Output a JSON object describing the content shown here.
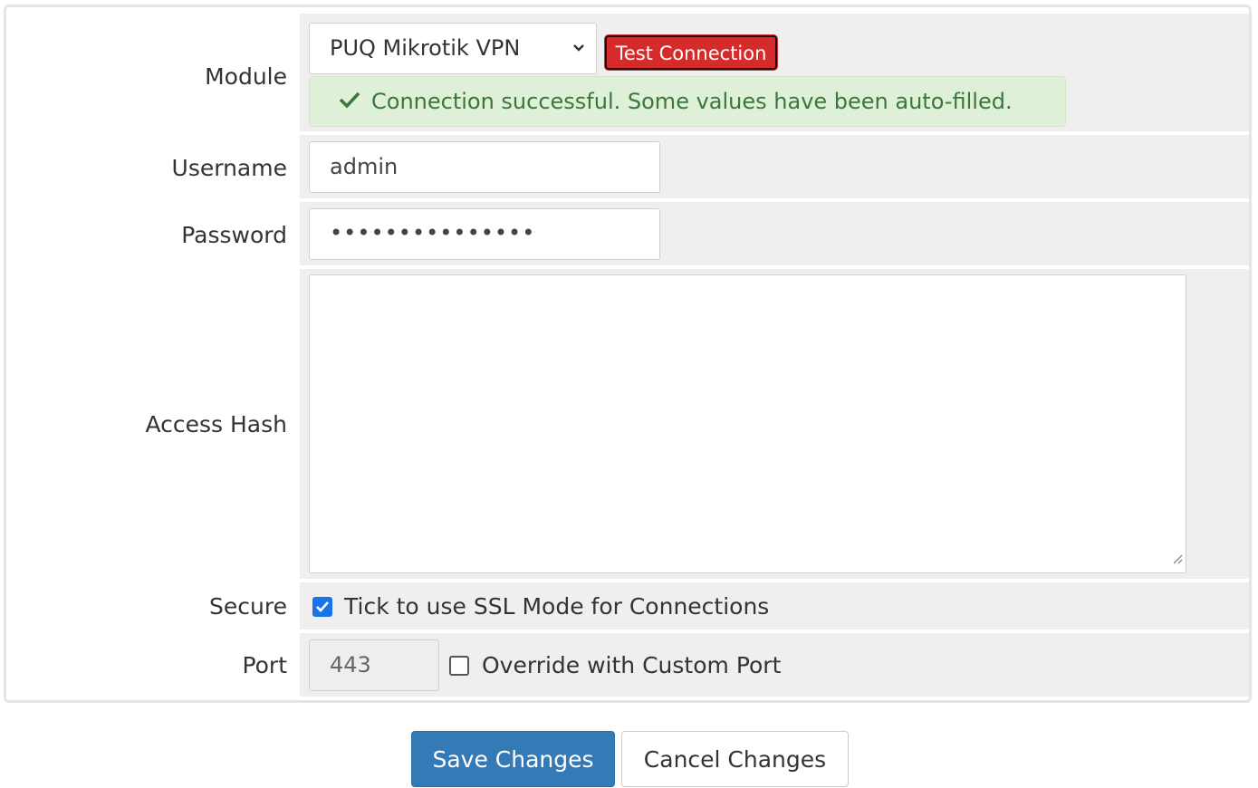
{
  "form": {
    "module": {
      "label": "Module",
      "selected": "PUQ Mikrotik VPN",
      "test_button": "Test Connection",
      "alert": "Connection successful. Some values have been auto-filled."
    },
    "username": {
      "label": "Username",
      "value": "admin"
    },
    "password": {
      "label": "Password",
      "value": "•••••••••••••••"
    },
    "access_hash": {
      "label": "Access Hash",
      "value": ""
    },
    "secure": {
      "label": "Secure",
      "checkbox_label": "Tick to use SSL Mode for Connections",
      "checked": true
    },
    "port": {
      "label": "Port",
      "value": "443",
      "override_label": "Override with Custom Port",
      "override_checked": false
    }
  },
  "actions": {
    "save_label": "Save Changes",
    "cancel_label": "Cancel Changes",
    "save_color": "#337ab7"
  },
  "icons": {
    "alert_icon": "check-icon",
    "select_icon": "chevron-down-icon"
  },
  "colors": {
    "test_button": "#d62b2b",
    "alert_bg": "#dff0d8",
    "alert_text": "#3c763d"
  }
}
